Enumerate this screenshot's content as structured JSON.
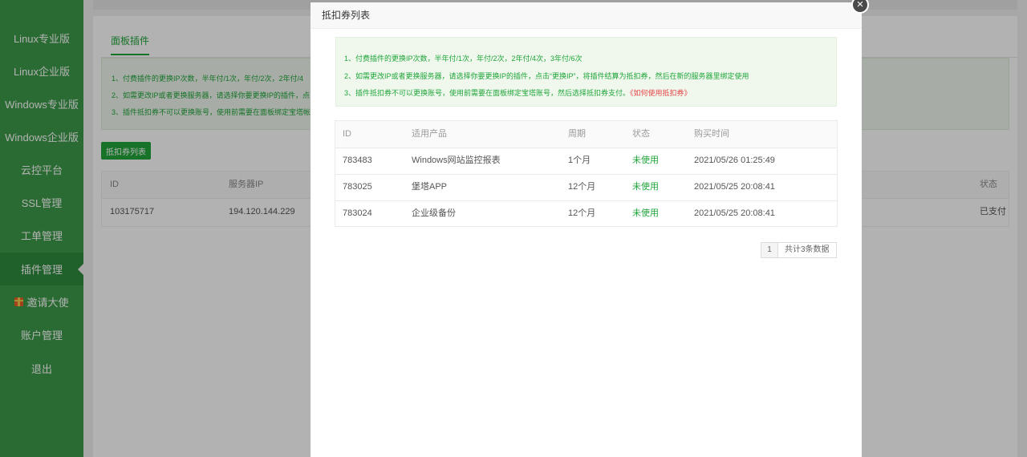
{
  "sidebar": {
    "items": [
      {
        "label": "Linux专业版"
      },
      {
        "label": "Linux企业版"
      },
      {
        "label": "Windows专业版"
      },
      {
        "label": "Windows企业版"
      },
      {
        "label": "云控平台"
      },
      {
        "label": "SSL管理"
      },
      {
        "label": "工单管理"
      },
      {
        "label": "插件管理"
      },
      {
        "label": "邀请大使",
        "icon": "gift-icon"
      },
      {
        "label": "账户管理"
      },
      {
        "label": "退出"
      }
    ],
    "active_index": 7,
    "colors": {
      "background": "#3c9a4a",
      "active": "#2f8a3d"
    }
  },
  "background_page": {
    "tab_label": "面板插件",
    "notice_lines": [
      "1、付费插件的更换IP次数，半年付/1次，年付/2次，2年付/4",
      "2、如需更改IP或者更换服务器，请选择你要更换IP的插件，点",
      "3、插件抵扣券不可以更换账号，使用前需要在面板绑定宝塔帐"
    ],
    "coupon_button_label": "抵扣券列表",
    "table": {
      "headers": {
        "id": "ID",
        "server_ip": "服务器IP",
        "status": "状态"
      },
      "row": {
        "id": "103175717",
        "server_ip": "194.120.144.229",
        "status": "已支付"
      }
    }
  },
  "modal": {
    "title": "抵扣券列表",
    "close_symbol": "×",
    "notice": {
      "line1": "1、付费插件的更换IP次数，半年付/1次，年付/2次，2年付/4次，3年付/6次",
      "line2": "2、如需更改IP或者更换服务器，请选择你要更换IP的插件，点击“更换IP”，将插件结算为抵扣券，然后在新的服务器里绑定使用",
      "line3": "3、插件抵扣券不可以更换账号，使用前需要在面板绑定宝塔账号，然后选择抵扣券支付。",
      "link": "《如何使用抵扣券》"
    },
    "table": {
      "headers": {
        "id": "ID",
        "product": "适用产品",
        "period": "周期",
        "status": "状态",
        "time": "购买时间"
      },
      "rows": [
        {
          "id": "783483",
          "product": "Windows网站监控报表",
          "period": "1个月",
          "status": "未使用",
          "time": "2021/05/26 01:25:49"
        },
        {
          "id": "783025",
          "product": "堡塔APP",
          "period": "12个月",
          "status": "未使用",
          "time": "2021/05/25 20:08:41"
        },
        {
          "id": "783024",
          "product": "企业级备份",
          "period": "12个月",
          "status": "未使用",
          "time": "2021/05/25 20:08:41"
        }
      ]
    },
    "pagination": {
      "current_page": "1",
      "total_label": "共计3条数据"
    }
  },
  "colors": {
    "accent": "#20a53a",
    "link": "#e64545"
  }
}
